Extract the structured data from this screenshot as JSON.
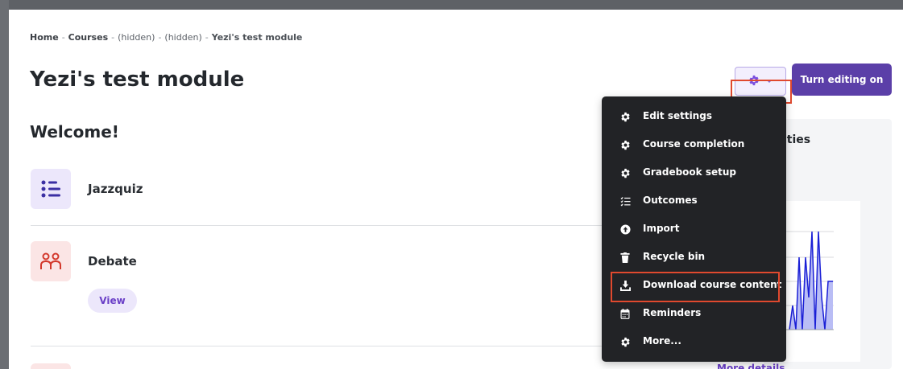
{
  "breadcrumb": {
    "home": "Home",
    "sep1": "-",
    "courses": "Courses",
    "sep2": "-",
    "hidden1": "(hidden)",
    "sep3": "-",
    "hidden2": "(hidden)",
    "sep4": "-",
    "current": "Yezi's test module"
  },
  "page": {
    "title": "Yezi's test module",
    "section_title": "Welcome!"
  },
  "activities": [
    {
      "name": "Jazzquiz",
      "icon": "list-icon"
    },
    {
      "name": "Debate",
      "icon": "people-icon",
      "view_label": "View"
    }
  ],
  "header_actions": {
    "gear_icon": "gear-icon",
    "edit_button": "Turn editing on"
  },
  "course_menu": {
    "items": [
      {
        "label": "Edit settings",
        "icon": "gear-icon"
      },
      {
        "label": "Course completion",
        "icon": "gear-icon"
      },
      {
        "label": "Gradebook setup",
        "icon": "gear-icon"
      },
      {
        "label": "Outcomes",
        "icon": "checklist-icon"
      },
      {
        "label": "Import",
        "icon": "upload-icon"
      },
      {
        "label": "Recycle bin",
        "icon": "trash-icon"
      },
      {
        "label": "Download course content",
        "icon": "download-icon"
      },
      {
        "label": "Reminders",
        "icon": "calendar-icon"
      },
      {
        "label": "More...",
        "icon": "gear-icon"
      }
    ]
  },
  "side_panel": {
    "heading_fragment": "ities",
    "more_details": "More details"
  },
  "colors": {
    "accent": "#5b3fa8",
    "highlight": "#e0492e",
    "menu_bg": "#222326",
    "chart_line": "#1a1fd6"
  }
}
